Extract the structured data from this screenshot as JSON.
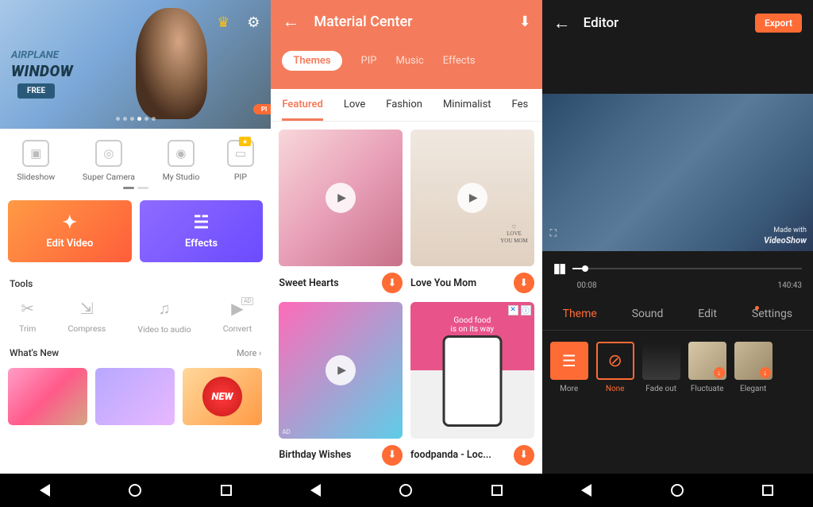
{
  "screen1": {
    "hero": {
      "title1": "AIRPLANE",
      "title2": "WINDOW",
      "badge": "FREE"
    },
    "actions": [
      {
        "label": "Slideshow"
      },
      {
        "label": "Super Camera"
      },
      {
        "label": "My Studio"
      },
      {
        "label": "PIP"
      }
    ],
    "bigButtons": {
      "edit": "Edit Video",
      "effects": "Effects"
    },
    "toolsTitle": "Tools",
    "tools": [
      {
        "label": "Trim"
      },
      {
        "label": "Compress"
      },
      {
        "label": "Video to audio"
      },
      {
        "label": "Convert"
      }
    ],
    "whatsNew": {
      "title": "What's New",
      "more": "More ›",
      "newBadge": "NEW"
    }
  },
  "screen2": {
    "title": "Material Center",
    "pills": [
      "Themes",
      "PIP",
      "Music",
      "Effects"
    ],
    "tabs": [
      "Featured",
      "Love",
      "Fashion",
      "Minimalist",
      "Fes"
    ],
    "cards": [
      {
        "name": "Sweet Hearts"
      },
      {
        "name": "Love You Mom",
        "caption": "LOVE\nYOU MOM"
      },
      {
        "name": "Birthday Wishes"
      },
      {
        "name": "foodpanda - Loc...",
        "foodText": "Good food\nis on its way"
      }
    ],
    "adLabel": "AD"
  },
  "screen3": {
    "title": "Editor",
    "export": "Export",
    "watermark": {
      "prefix": "Made with",
      "brand": "VideoShow"
    },
    "time": {
      "current": "00:08",
      "total": "140:43"
    },
    "tabs": [
      "Theme",
      "Sound",
      "Edit",
      "Settings"
    ],
    "themes": [
      {
        "label": "More"
      },
      {
        "label": "None"
      },
      {
        "label": "Fade out"
      },
      {
        "label": "Fluctuate"
      },
      {
        "label": "Elegant"
      }
    ]
  }
}
